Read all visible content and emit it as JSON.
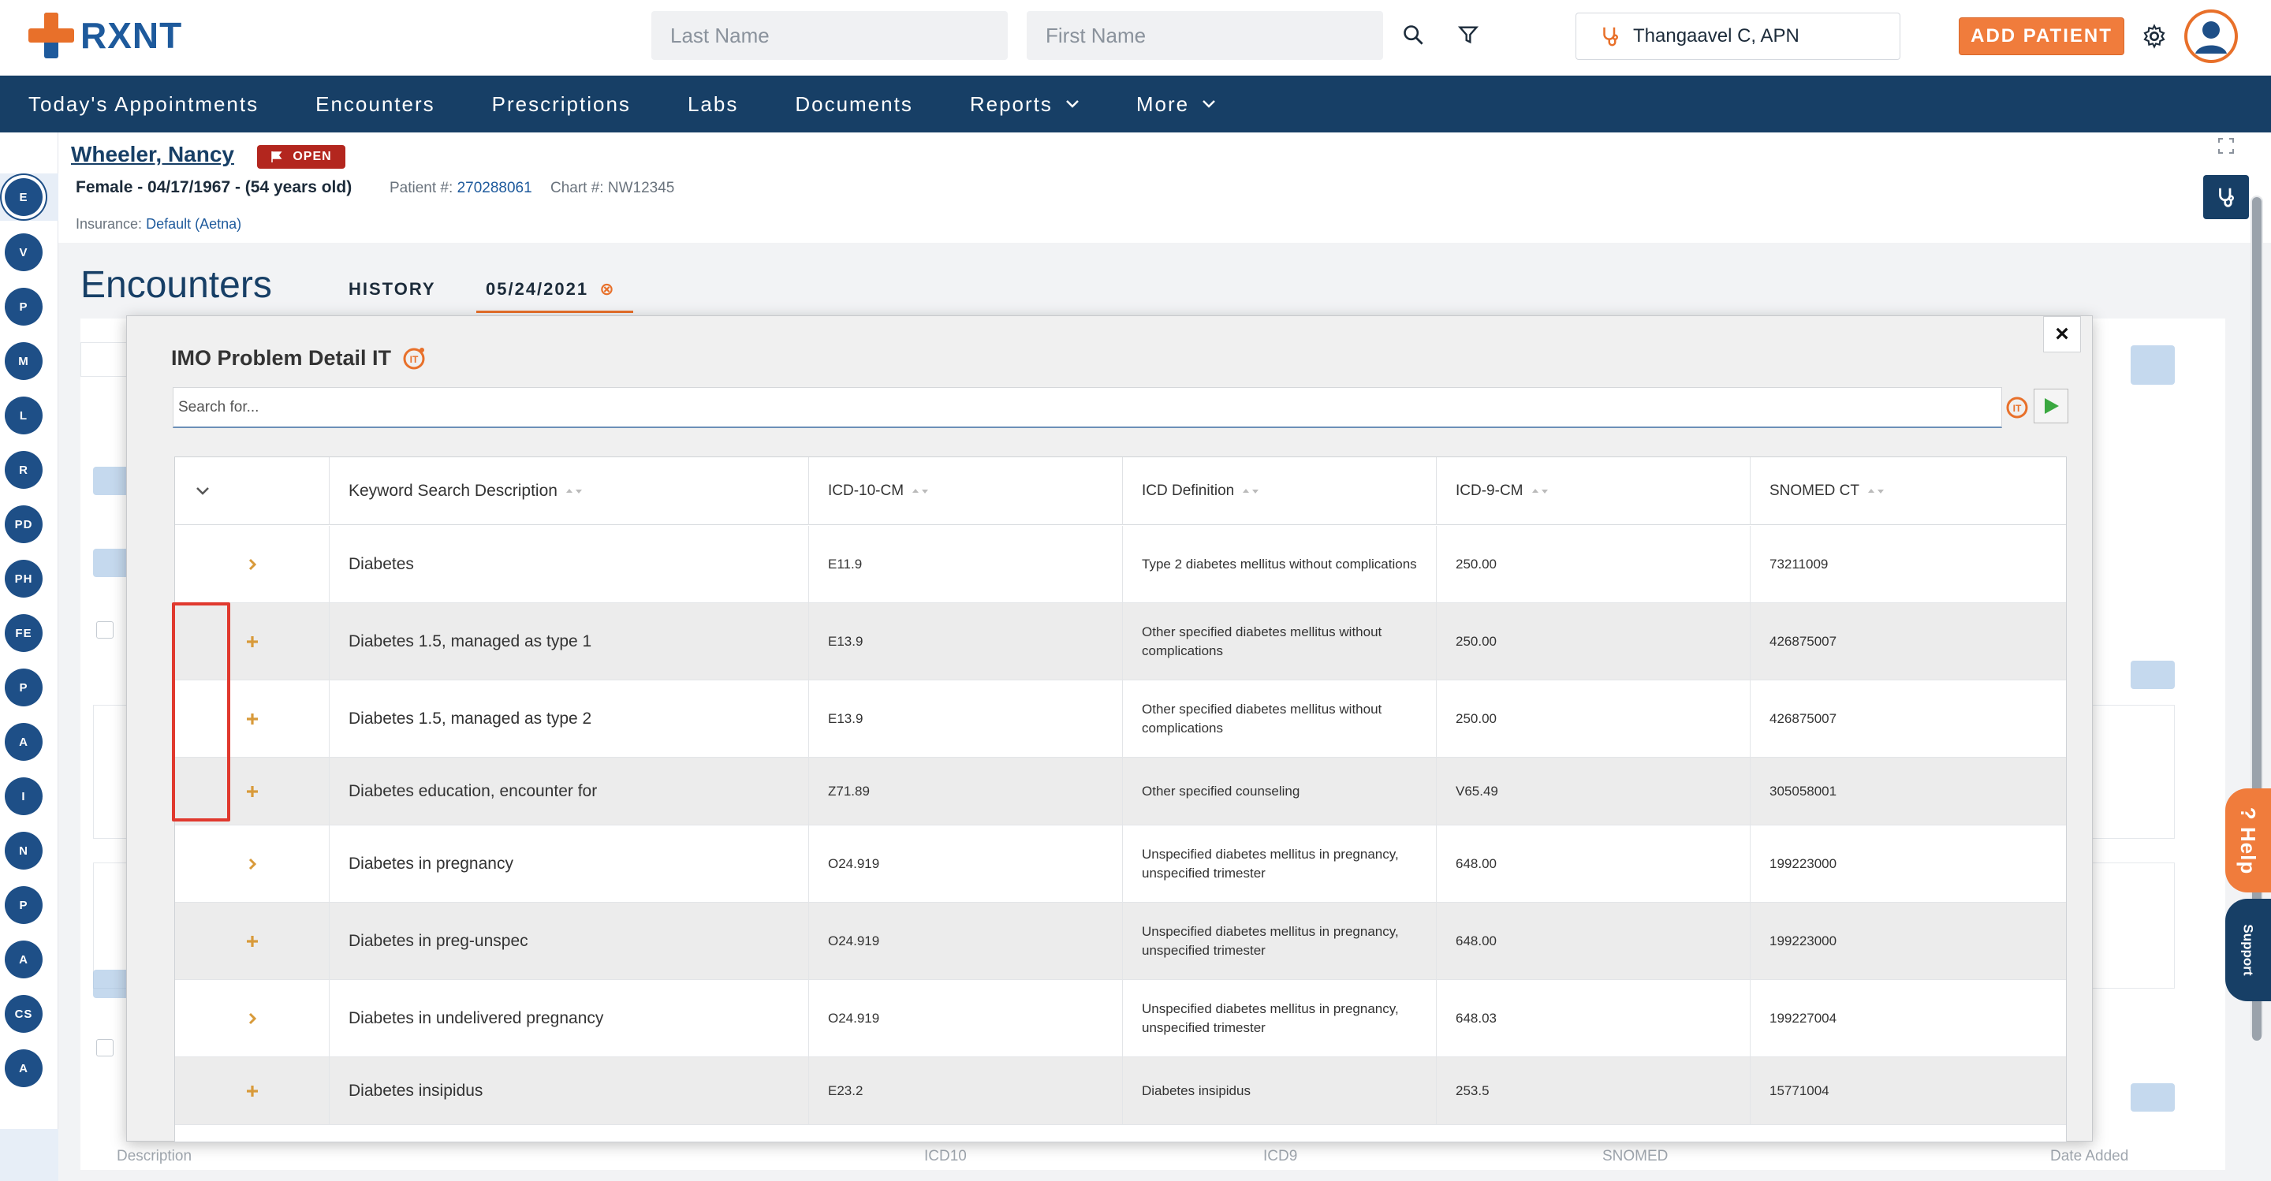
{
  "brand": {
    "name": "RXNT"
  },
  "header": {
    "last_name_placeholder": "Last Name",
    "first_name_placeholder": "First Name",
    "provider": "Thangaavel C, APN",
    "add_patient": "ADD PATIENT"
  },
  "nav": {
    "items": [
      {
        "label": "Today's Appointments"
      },
      {
        "label": "Encounters"
      },
      {
        "label": "Prescriptions"
      },
      {
        "label": "Labs"
      },
      {
        "label": "Documents"
      },
      {
        "label": "Reports"
      },
      {
        "label": "More"
      }
    ]
  },
  "rail": {
    "items": [
      "E",
      "V",
      "P",
      "M",
      "L",
      "R",
      "PD",
      "PH",
      "FE",
      "P",
      "A",
      "I",
      "N",
      "P",
      "A",
      "CS",
      "A"
    ]
  },
  "patient": {
    "name": "Wheeler, Nancy",
    "status": "OPEN",
    "demographics": "Female - 04/17/1967 - (54 years old)",
    "patient_no_label": "Patient #:",
    "patient_no": "270288061",
    "chart_no_label": "Chart #:",
    "chart_no": "NW12345",
    "insurance_label": "Insurance:",
    "insurance": "Default (Aetna)"
  },
  "encounters": {
    "title": "Encounters",
    "tab_history": "HISTORY",
    "tab_date": "05/24/2021"
  },
  "footer_columns": {
    "description": "Description",
    "icd10": "ICD10",
    "icd9": "ICD9",
    "snomed": "SNOMED",
    "date_added": "Date Added"
  },
  "help": {
    "help": "? Help",
    "support": "Support"
  },
  "modal": {
    "title": "IMO Problem Detail IT",
    "close": "×",
    "search_placeholder": "Search for...",
    "columns": {
      "keyword": "Keyword Search Description",
      "icd10": "ICD-10-CM",
      "definition": "ICD Definition",
      "icd9": "ICD-9-CM",
      "snomed": "SNOMED CT"
    },
    "rows": [
      {
        "toggle": "chevron",
        "keyword": "Diabetes",
        "icd10": "E11.9",
        "definition": "Type 2 diabetes mellitus without complications",
        "icd9": "250.00",
        "snomed": "73211009"
      },
      {
        "toggle": "plus",
        "keyword": "Diabetes 1.5, managed as type 1",
        "icd10": "E13.9",
        "definition": "Other specified diabetes mellitus without complications",
        "icd9": "250.00",
        "snomed": "426875007"
      },
      {
        "toggle": "plus",
        "keyword": "Diabetes 1.5, managed as type 2",
        "icd10": "E13.9",
        "definition": "Other specified diabetes mellitus without complications",
        "icd9": "250.00",
        "snomed": "426875007"
      },
      {
        "toggle": "plus",
        "keyword": "Diabetes education, encounter for",
        "icd10": "Z71.89",
        "definition": "Other specified counseling",
        "icd9": "V65.49",
        "snomed": "305058001"
      },
      {
        "toggle": "chevron",
        "keyword": "Diabetes in pregnancy",
        "icd10": "O24.919",
        "definition": "Unspecified diabetes mellitus in pregnancy, unspecified trimester",
        "icd9": "648.00",
        "snomed": "199223000"
      },
      {
        "toggle": "plus",
        "keyword": "Diabetes in preg-unspec",
        "icd10": "O24.919",
        "definition": "Unspecified diabetes mellitus in pregnancy, unspecified trimester",
        "icd9": "648.00",
        "snomed": "199223000"
      },
      {
        "toggle": "chevron",
        "keyword": "Diabetes in undelivered pregnancy",
        "icd10": "O24.919",
        "definition": "Unspecified diabetes mellitus in pregnancy, unspecified trimester",
        "icd9": "648.03",
        "snomed": "199227004"
      },
      {
        "toggle": "plus",
        "keyword": "Diabetes insipidus",
        "icd10": "E23.2",
        "definition": "Diabetes insipidus",
        "icd9": "253.5",
        "snomed": "15771004"
      }
    ]
  },
  "colors": {
    "navy": "#173f66",
    "orange": "#f07c3c",
    "red_badge": "#b3261e",
    "highlight": "#e0392e"
  }
}
